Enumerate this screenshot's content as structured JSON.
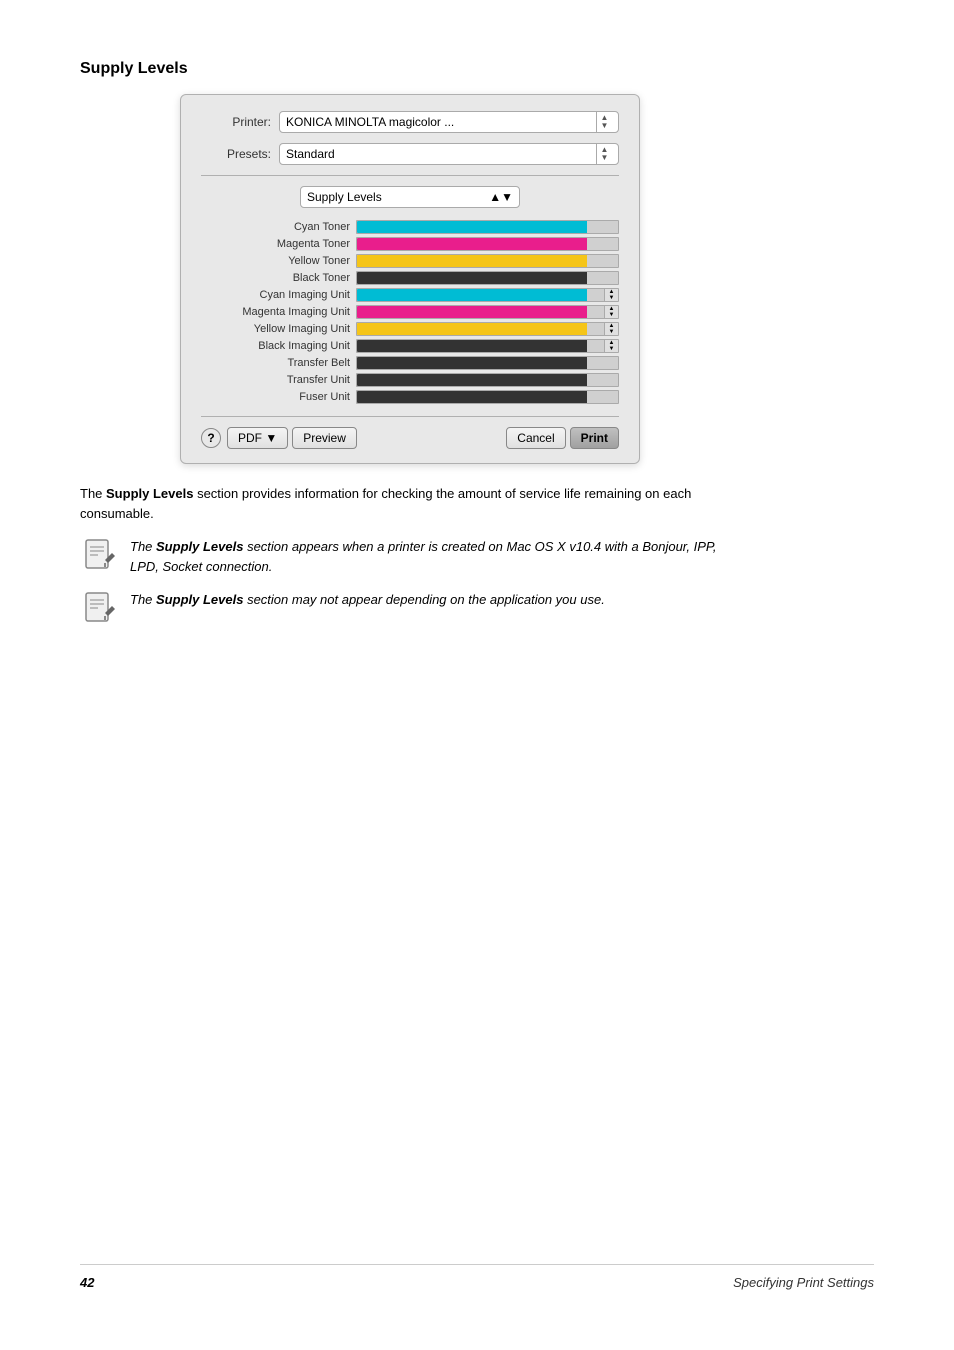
{
  "section": {
    "title": "Supply Levels"
  },
  "dialog": {
    "printer_label": "Printer:",
    "printer_value": "KONICA MINOLTA magicolor ...",
    "presets_label": "Presets:",
    "presets_value": "Standard",
    "supply_levels_label": "Supply Levels",
    "supplies": [
      {
        "name": "Cyan Toner",
        "color": "#00bcd4",
        "fill": 88,
        "has_stepper": false
      },
      {
        "name": "Magenta Toner",
        "color": "#e91e8c",
        "fill": 88,
        "has_stepper": false
      },
      {
        "name": "Yellow Toner",
        "color": "#f5c518",
        "fill": 88,
        "has_stepper": false
      },
      {
        "name": "Black Toner",
        "color": "#333333",
        "fill": 88,
        "has_stepper": false
      },
      {
        "name": "Cyan Imaging Unit",
        "color": "#00bcd4",
        "fill": 88,
        "has_stepper": true
      },
      {
        "name": "Magenta Imaging Unit",
        "color": "#e91e8c",
        "fill": 88,
        "has_stepper": true
      },
      {
        "name": "Yellow Imaging Unit",
        "color": "#f5c518",
        "fill": 88,
        "has_stepper": true
      },
      {
        "name": "Black Imaging Unit",
        "color": "#333333",
        "fill": 88,
        "has_stepper": true
      },
      {
        "name": "Transfer Belt",
        "color": "#333333",
        "fill": 88,
        "has_stepper": false
      },
      {
        "name": "Transfer Unit",
        "color": "#333333",
        "fill": 88,
        "has_stepper": false
      },
      {
        "name": "Fuser Unit",
        "color": "#333333",
        "fill": 88,
        "has_stepper": false
      }
    ],
    "help_label": "?",
    "pdf_label": "PDF ▼",
    "preview_label": "Preview",
    "cancel_label": "Cancel",
    "print_label": "Print"
  },
  "body": {
    "intro": "The ",
    "intro_bold": "Supply Levels",
    "intro_rest": " section provides information for checking the amount of service life remaining on each consumable.",
    "note1_italic_bold": "Supply Levels",
    "note1_text": " section appears when a printer is created on Mac OS X v10.4 with a Bonjour, IPP, LPD, Socket connection.",
    "note1_prefix": "The ",
    "note2_italic_bold": "Supply Levels",
    "note2_text": " section may not appear depending on the application you use.",
    "note2_prefix": "The "
  },
  "footer": {
    "page_number": "42",
    "title": "Specifying Print Settings"
  }
}
